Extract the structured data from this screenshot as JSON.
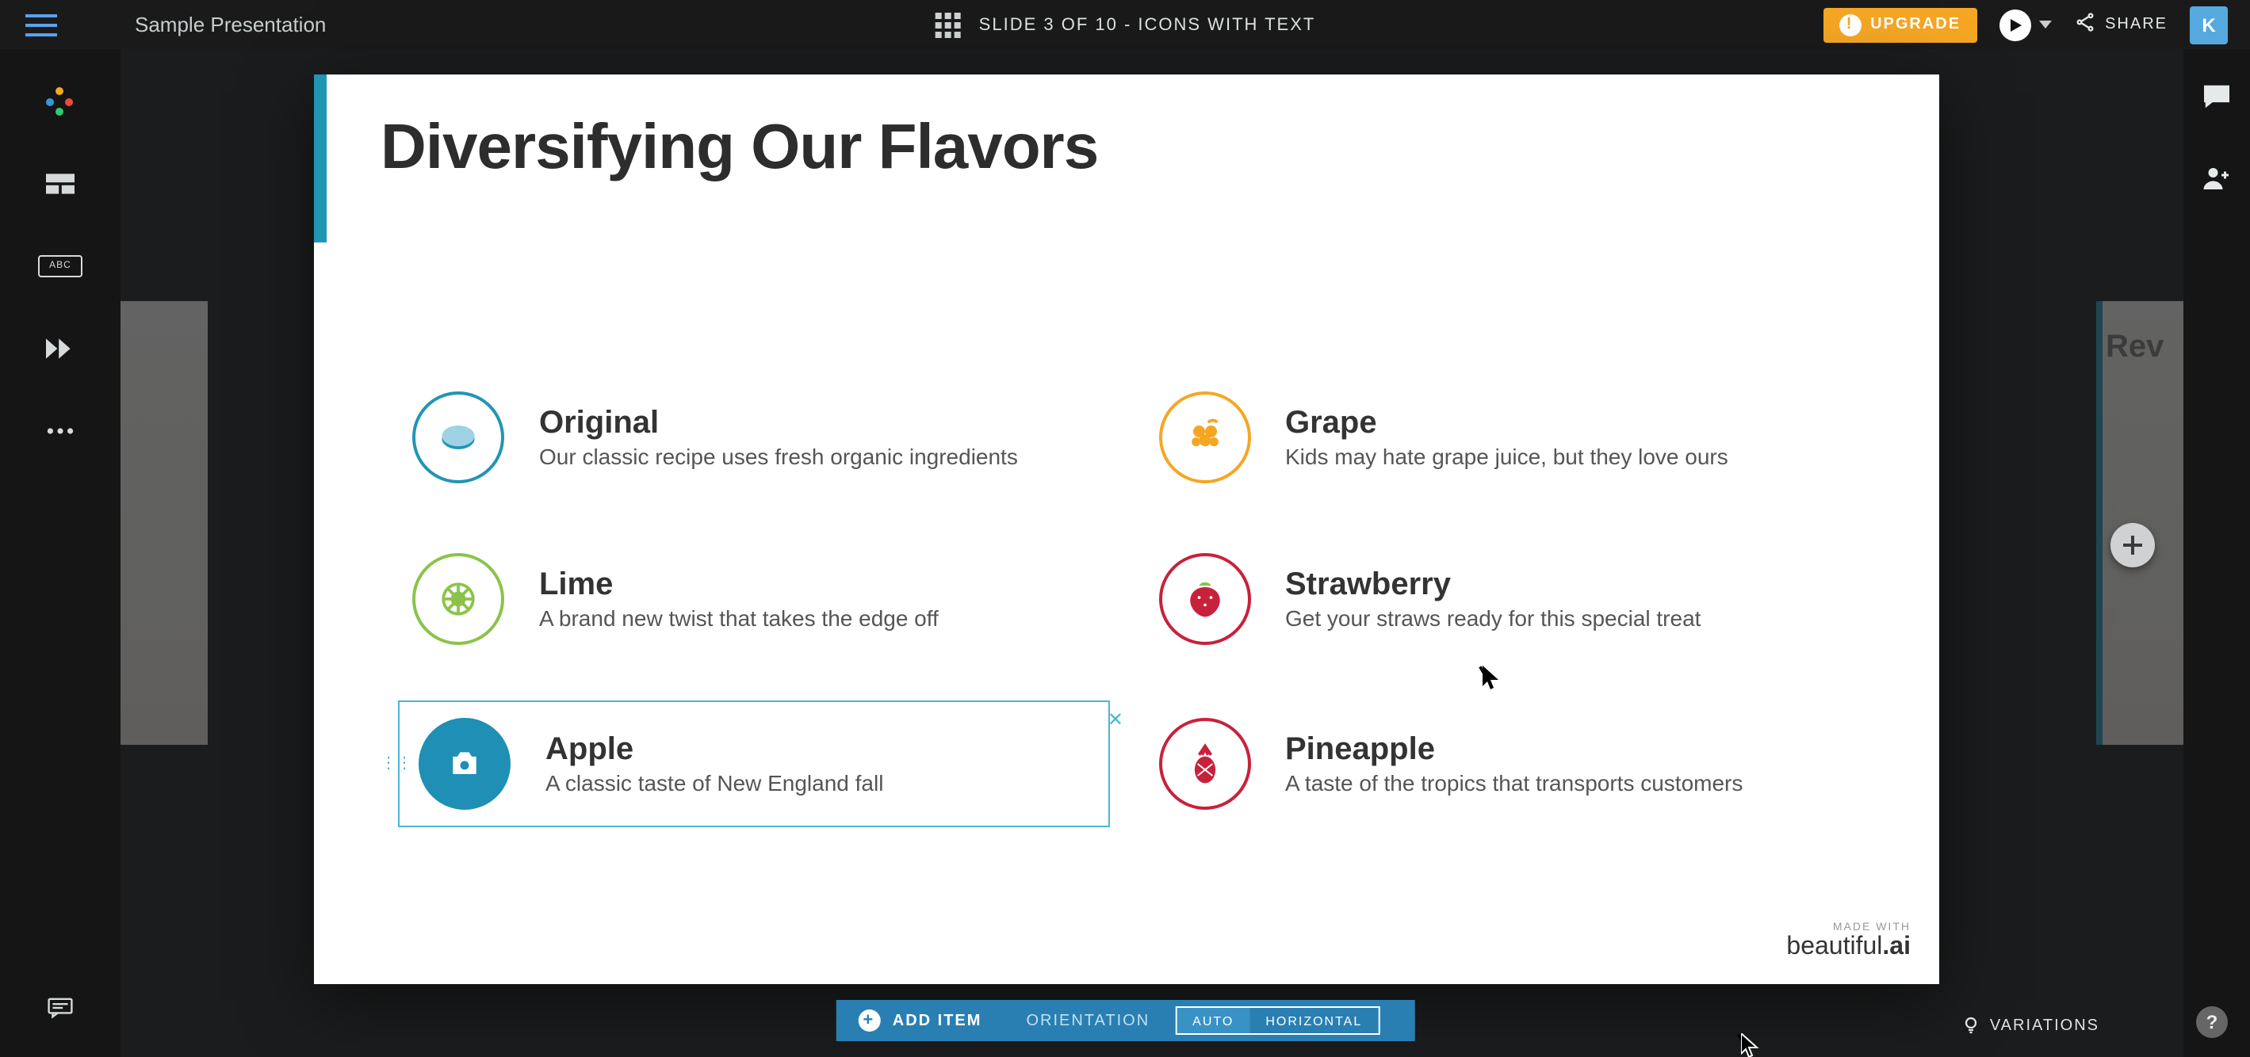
{
  "header": {
    "doc_title": "Sample Presentation",
    "slide_indicator": "SLIDE 3 OF 10 - ICONS WITH TEXT",
    "upgrade_label": "UPGRADE",
    "share_label": "SHARE",
    "avatar_initial": "K"
  },
  "left_sidebar": {
    "abc_label": "ABC"
  },
  "ghost_right_title": "Rev",
  "slide": {
    "title": "Diversifying Our Flavors",
    "items": [
      {
        "title": "Original",
        "sub": "Our classic recipe uses fresh organic ingredients",
        "color": "#2195b4",
        "icon": "lemon"
      },
      {
        "title": "Grape",
        "sub": "Kids may hate grape juice, but they love ours",
        "color": "#f5a623",
        "icon": "grape"
      },
      {
        "title": "Lime",
        "sub": "A brand new twist that takes the edge off",
        "color": "#8bc34a",
        "icon": "lime"
      },
      {
        "title": "Strawberry",
        "sub": "Get your straws ready for this special treat",
        "color": "#c8213c",
        "icon": "strawberry"
      },
      {
        "title": "Apple",
        "sub": "A classic taste of New England fall",
        "color": "#2195b4",
        "icon": "camera",
        "selected": true
      },
      {
        "title": "Pineapple",
        "sub": "A taste of the tropics that transports customers",
        "color": "#c8213c",
        "icon": "pineapple"
      }
    ],
    "watermark_small": "MADE WITH",
    "watermark_big_a": "beautiful",
    "watermark_big_b": ".ai"
  },
  "bottombar": {
    "add_label": "ADD ITEM",
    "orientation_label": "ORIENTATION",
    "toggle_auto": "AUTO",
    "toggle_horizontal": "HORIZONTAL"
  },
  "variations_label": "VARIATIONS",
  "help_label": "?"
}
